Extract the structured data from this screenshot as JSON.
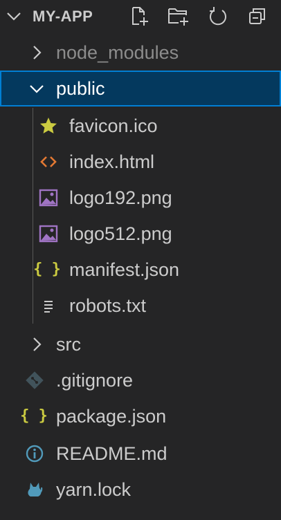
{
  "explorer": {
    "title": "MY-APP",
    "actions": [
      {
        "name": "new-file-icon"
      },
      {
        "name": "new-folder-icon"
      },
      {
        "name": "refresh-icon"
      },
      {
        "name": "collapse-all-icon"
      }
    ]
  },
  "tree": {
    "node_modules": "node_modules",
    "public": "public",
    "public_children": {
      "favicon": "favicon.ico",
      "index": "index.html",
      "logo192": "logo192.png",
      "logo512": "logo512.png",
      "manifest": "manifest.json",
      "robots": "robots.txt"
    },
    "src": "src",
    "gitignore": ".gitignore",
    "package": "package.json",
    "readme": "README.md",
    "yarn": "yarn.lock"
  },
  "colors": {
    "background": "#252526",
    "selection_bg": "#04395e",
    "selection_border": "#007fd4",
    "json_icon": "#cbcb41",
    "html_icon": "#e37933",
    "image_icon": "#a074c4",
    "info_icon": "#519aba",
    "yarn_icon": "#519aba",
    "git_icon": "#41535b",
    "star_icon": "#cbcb41"
  },
  "icons": {
    "favicon": "star-icon",
    "index": "html-icon",
    "logo": "image-icon",
    "manifest": "json-icon",
    "robots": "text-file-icon",
    "gitignore": "git-icon",
    "package": "json-icon",
    "readme": "info-icon",
    "yarn": "yarn-icon"
  }
}
